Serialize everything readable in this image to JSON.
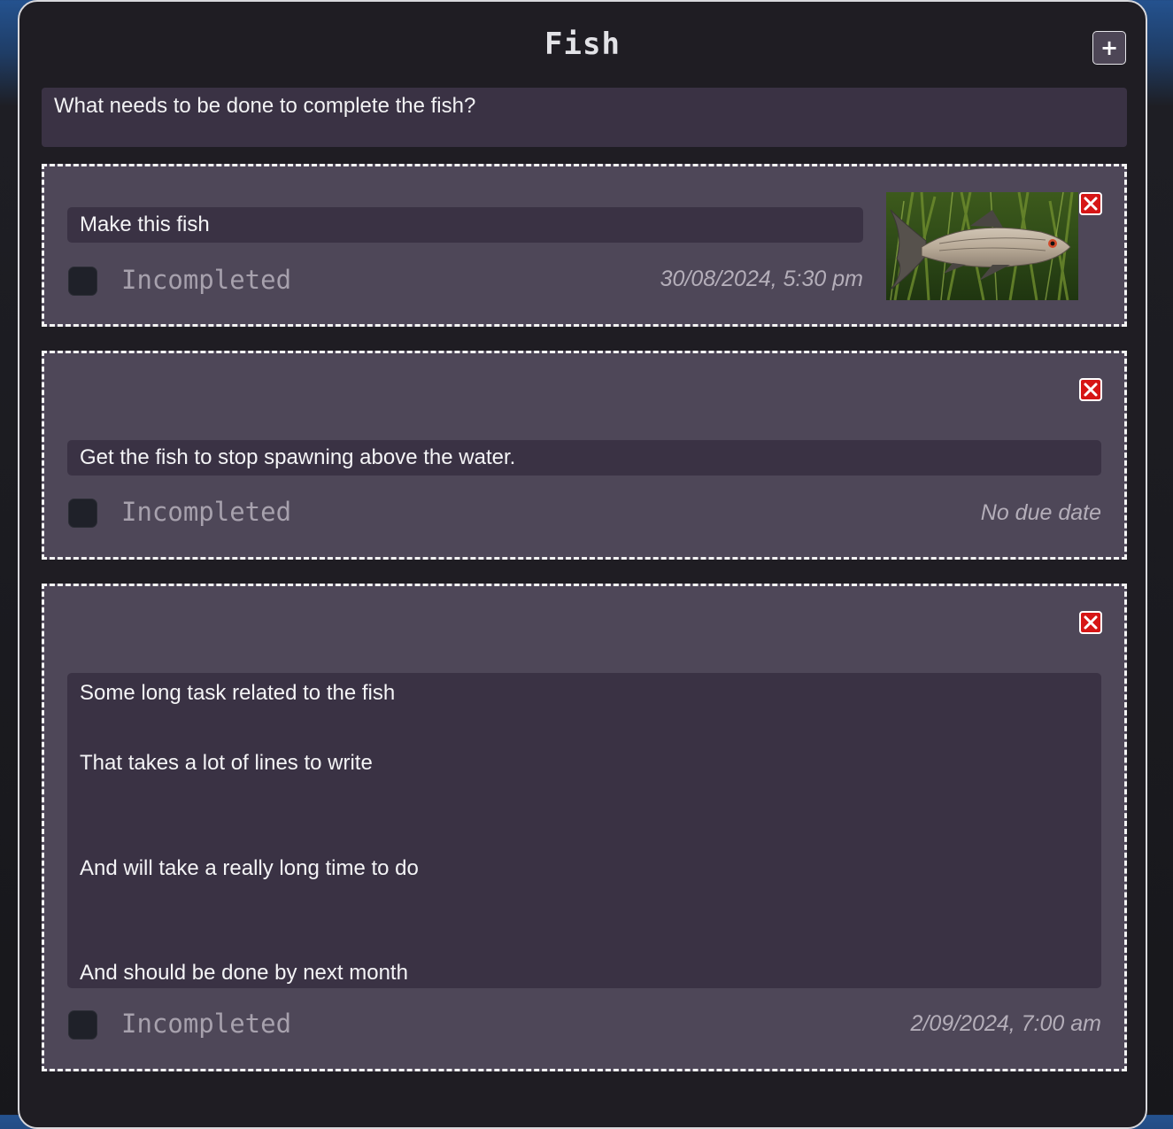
{
  "list": {
    "title": "Fish",
    "add_label": "+",
    "question": "What needs to be done to complete the fish?"
  },
  "tasks": [
    {
      "text": "Make this fish",
      "status": "Incompleted",
      "due": "30/08/2024, 5:30 pm",
      "has_image": true,
      "image_desc_icon": "fish-photo"
    },
    {
      "text": "Get the fish to stop spawning above the water.",
      "status": "Incompleted",
      "due": "No due date"
    },
    {
      "text": "Some long task related to the fish\n\nThat takes a lot of lines to write\n\n\nAnd will take a really long time to do\n\n\nAnd should be done by next month",
      "status": "Incompleted",
      "due": "2/09/2024, 7:00 am"
    }
  ],
  "colors": {
    "panel_bg": "#1f1d23",
    "card_bg": "#4e4758",
    "input_bg": "#3a3244",
    "delete_red": "#d61616"
  }
}
